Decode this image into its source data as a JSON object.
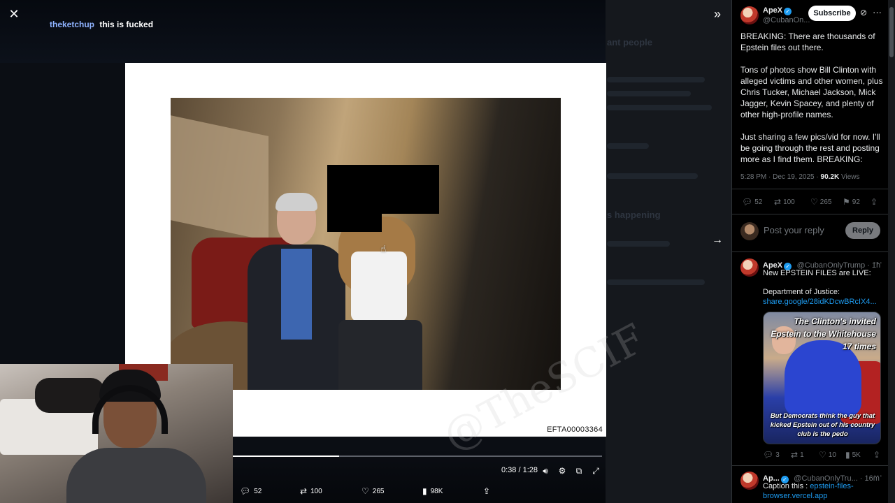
{
  "viewer": {
    "caption_user": "theketchup",
    "caption_message": "this is fucked",
    "doc_id": "EFTA00003364",
    "watermark": "@TheSCIF",
    "time": "0:38 / 1:28",
    "progress": 0.288,
    "actions": {
      "replies": "52",
      "reposts": "100",
      "likes": "265",
      "views": "98K"
    },
    "icons": {
      "close": "close-icon",
      "collapse": "double-chevron-right-icon",
      "next": "arrow-right-icon",
      "volume": "volume-icon",
      "settings": "gear-icon",
      "pip": "picture-in-picture-icon",
      "fullscreen": "fullscreen-icon"
    }
  },
  "tweet": {
    "author_name": "ApeX",
    "author_handle": "@CubanOn...",
    "subscribe_label": "Subscribe",
    "paragraphs": [
      "BREAKING: There are thousands of Epstein files out there.",
      "Tons of photos show Bill Clinton with alleged victims and other women, plus Chris Tucker, Michael Jackson, Mick Jagger, Kevin Spacey, and plenty of other high-profile names.",
      "Just sharing a few pics/vid for now. I'll be going through the rest and posting more as I find them. BREAKING:"
    ],
    "timestamp": "5:28 PM · Dec 19, 2025 ·",
    "views_count": "90.2K",
    "views_label": "Views",
    "stats": {
      "replies": "52",
      "reposts": "100",
      "likes": "265",
      "bookmarks": "92"
    }
  },
  "reply_box": {
    "placeholder": "Post your reply",
    "button": "Reply"
  },
  "replies": [
    {
      "name": "ApeX",
      "handle": "@CubanOnlyTrump · 1h",
      "line1": "New EPSTEIN FILES are LIVE:",
      "line2": "Department of Justice:",
      "link": "share.google/28idKDcwBRcIX4...",
      "meme_top": "The Clinton's invited Epstein to the Whitehouse 17 times",
      "meme_bottom": "But Democrats think the guy that kicked Epstein out of his country club is the pedo",
      "stats": {
        "replies": "3",
        "reposts": "1",
        "likes": "10",
        "views": "5K"
      }
    },
    {
      "name": "Ap...",
      "handle": "@CubanOnlyTru... · 16m",
      "caption_prefix": "Caption this :",
      "link": "epstein-files-browser.vercel.app"
    }
  ]
}
